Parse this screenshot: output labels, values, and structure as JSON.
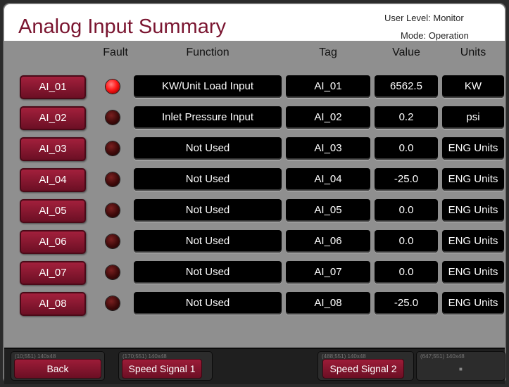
{
  "header": {
    "title": "Analog Input Summary",
    "user_level": "User Level: Monitor",
    "mode": "Mode: Operation"
  },
  "columns": {
    "fault": "Fault",
    "function": "Function",
    "tag": "Tag",
    "value": "Value",
    "units": "Units"
  },
  "rows": [
    {
      "button": "AI_01",
      "fault": true,
      "function": "KW/Unit Load Input",
      "tag": "AI_01",
      "value": "6562.5",
      "units": "KW"
    },
    {
      "button": "AI_02",
      "fault": false,
      "function": "Inlet Pressure Input",
      "tag": "AI_02",
      "value": "0.2",
      "units": "psi"
    },
    {
      "button": "AI_03",
      "fault": false,
      "function": "Not Used",
      "tag": "AI_03",
      "value": "0.0",
      "units": "ENG Units"
    },
    {
      "button": "AI_04",
      "fault": false,
      "function": "Not Used",
      "tag": "AI_04",
      "value": "-25.0",
      "units": "ENG Units"
    },
    {
      "button": "AI_05",
      "fault": false,
      "function": "Not Used",
      "tag": "AI_05",
      "value": "0.0",
      "units": "ENG Units"
    },
    {
      "button": "AI_06",
      "fault": false,
      "function": "Not Used",
      "tag": "AI_06",
      "value": "0.0",
      "units": "ENG Units"
    },
    {
      "button": "AI_07",
      "fault": false,
      "function": "Not Used",
      "tag": "AI_07",
      "value": "0.0",
      "units": "ENG Units"
    },
    {
      "button": "AI_08",
      "fault": false,
      "function": "Not Used",
      "tag": "AI_08",
      "value": "-25.0",
      "units": "ENG Units"
    }
  ],
  "footer": {
    "back": {
      "meta": "(10;551) 140x48",
      "label": "Back"
    },
    "speed1": {
      "meta": "(170;551) 140x48",
      "label": "Speed Signal 1"
    },
    "speed2": {
      "meta": "(488;551) 140x48",
      "label": "Speed Signal 2"
    },
    "empty": {
      "meta": "(647;551) 140x48",
      "label": "■"
    }
  },
  "colors": {
    "accent": "#7a1530",
    "button": "#8c1a32",
    "led_on": "#ff1a1a",
    "led_off": "#3f0a0a"
  }
}
